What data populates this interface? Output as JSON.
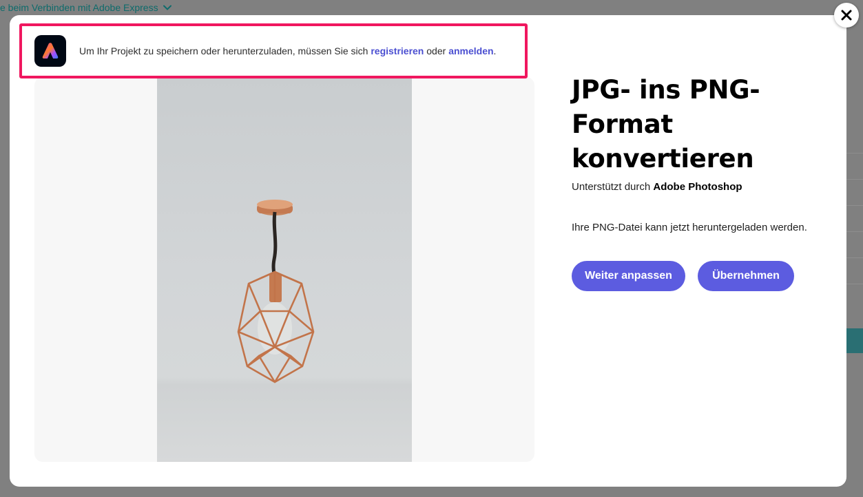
{
  "background": {
    "help_text": "e beim Verbinden mit Adobe Express"
  },
  "banner": {
    "text_before": "Um Ihr Projekt zu speichern oder herunterzuladen, müssen Sie sich ",
    "register_link": "registrieren",
    "text_middle": " oder ",
    "login_link": "anmelden",
    "text_after": "."
  },
  "main": {
    "title": "JPG- ins PNG-Format konvertieren",
    "powered_prefix": "Unterstützt durch ",
    "powered_brand": "Adobe Photoshop",
    "status": "Ihre PNG-Datei kann jetzt heruntergeladen werden.",
    "continue_button": "Weiter anpassen",
    "apply_button": "Übernehmen"
  },
  "icons": {
    "logo": "adobe-express-logo",
    "close": "close-icon",
    "chevron": "chevron-down-icon"
  },
  "colors": {
    "accent": "#5c5ce0",
    "link": "#4b4fd1",
    "highlight_border": "#f0175f",
    "overlay": "#808080"
  }
}
